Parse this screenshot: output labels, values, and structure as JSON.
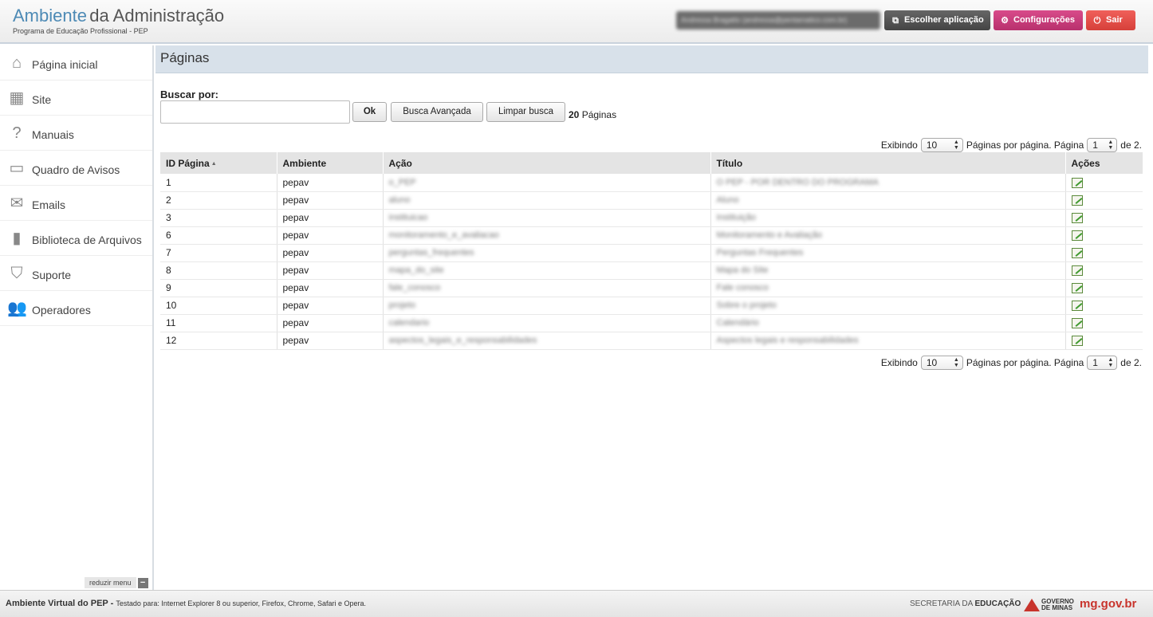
{
  "header": {
    "brand_part1": "Ambiente",
    "brand_part2": "da Administração",
    "subtitle": "Programa de Educação Profissional - PEP",
    "user_text": "Andressa Bragatto (andressa@pentamatico.com.br)",
    "escolher_label": "Escolher aplicação",
    "config_label": "Configurações",
    "sair_label": "Sair",
    "colors": {
      "brand_blue": "#4d8ab5",
      "config": "#c63a7b",
      "sair": "#e3504a",
      "escolher": "#555555"
    }
  },
  "sidebar": {
    "items": [
      {
        "label": "Página inicial",
        "icon": "home-icon"
      },
      {
        "label": "Site",
        "icon": "layout-icon"
      },
      {
        "label": "Manuais",
        "icon": "question-icon"
      },
      {
        "label": "Quadro de Avisos",
        "icon": "window-icon"
      },
      {
        "label": "Emails",
        "icon": "envelope-icon"
      },
      {
        "label": "Biblioteca de Arquivos",
        "icon": "book-icon"
      },
      {
        "label": "Suporte",
        "icon": "tag-icon"
      },
      {
        "label": "Operadores",
        "icon": "users-icon"
      }
    ],
    "reduzir_label": "reduzir menu",
    "reduzir_symbol": "−"
  },
  "main": {
    "title": "Páginas",
    "search": {
      "label": "Buscar por:",
      "value": "",
      "ok_label": "Ok",
      "advanced_label": "Busca Avançada",
      "clear_label": "Limpar busca",
      "total_count": "20",
      "total_unit": "Páginas"
    },
    "pager": {
      "prefix": "Exibindo",
      "per_page": "10",
      "middle": "Páginas por página. Página",
      "current_page": "1",
      "suffix": "de 2."
    },
    "table": {
      "columns": [
        "ID Página",
        "Ambiente",
        "Ação",
        "Título",
        "Ações"
      ],
      "rows": [
        {
          "id": "1",
          "ambiente": "pepav",
          "acao": "o_PEP",
          "titulo": "O PEP - POR DENTRO DO PROGRAMA"
        },
        {
          "id": "2",
          "ambiente": "pepav",
          "acao": "aluno",
          "titulo": "Aluno"
        },
        {
          "id": "3",
          "ambiente": "pepav",
          "acao": "instituicao",
          "titulo": "Instituição"
        },
        {
          "id": "6",
          "ambiente": "pepav",
          "acao": "monitoramento_e_avaliacao",
          "titulo": "Monitoramento e Avaliação"
        },
        {
          "id": "7",
          "ambiente": "pepav",
          "acao": "perguntas_frequentes",
          "titulo": "Perguntas Frequentes"
        },
        {
          "id": "8",
          "ambiente": "pepav",
          "acao": "mapa_do_site",
          "titulo": "Mapa do Site"
        },
        {
          "id": "9",
          "ambiente": "pepav",
          "acao": "fale_conosco",
          "titulo": "Fale conosco"
        },
        {
          "id": "10",
          "ambiente": "pepav",
          "acao": "projeto",
          "titulo": "Sobre o projeto"
        },
        {
          "id": "11",
          "ambiente": "pepav",
          "acao": "calendario",
          "titulo": "Calendário"
        },
        {
          "id": "12",
          "ambiente": "pepav",
          "acao": "aspectos_legais_e_responsabilidades",
          "titulo": "Aspectos legais e responsabilidades"
        }
      ]
    }
  },
  "footer": {
    "app_name": "Ambiente Virtual do PEP -",
    "tested": "Testado para: Internet Explorer 8 ou superior, Firefox, Chrome, Safari e Opera.",
    "secretaria_prefix": "SECRETARIA DA",
    "secretaria_bold": "EDUCAÇÃO",
    "gov_line1": "GOVERNO",
    "gov_line2": "DE MINAS",
    "mg": "mg.gov.br"
  }
}
